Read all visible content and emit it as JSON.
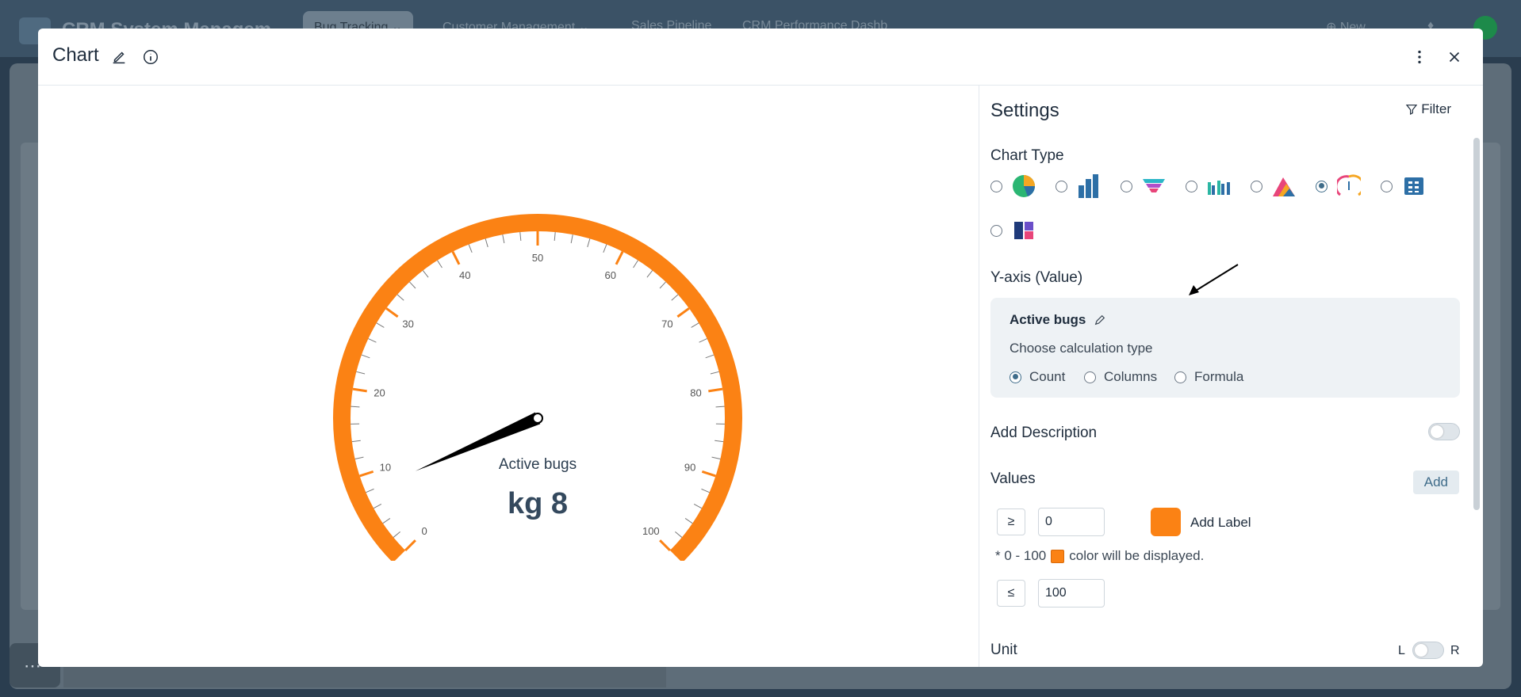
{
  "background": {
    "app_title": "CRM System Managem",
    "tabs": [
      {
        "label": "Bug Tracking  ⌄"
      },
      {
        "label": "Customer Management  ⌄"
      },
      {
        "label": "Sales Pipeline"
      },
      {
        "label": "CRM Performance Dashb"
      }
    ],
    "new_label": "⊕ New"
  },
  "modal": {
    "title": "Chart",
    "icons": [
      "edit-pencil-icon",
      "info-icon",
      "more-vert-icon",
      "close-icon"
    ]
  },
  "gauge": {
    "label": "Active bugs",
    "value_text": "kg 8",
    "value": 8,
    "min": 0,
    "max": 100,
    "ticks": [
      "0",
      "10",
      "20",
      "30",
      "40",
      "50",
      "60",
      "70",
      "80",
      "90",
      "100"
    ],
    "color": "#fb8214"
  },
  "settings": {
    "title": "Settings",
    "filter_label": "Filter",
    "chart_type_label": "Chart Type",
    "chart_types": [
      {
        "icon": "pie-chart-icon",
        "selected": false
      },
      {
        "icon": "bar-chart-icon",
        "selected": false
      },
      {
        "icon": "funnel-chart-icon",
        "selected": false
      },
      {
        "icon": "grouped-bar-chart-icon",
        "selected": false
      },
      {
        "icon": "area-chart-icon",
        "selected": false
      },
      {
        "icon": "gauge-chart-icon",
        "selected": true
      },
      {
        "icon": "pivot-table-icon",
        "selected": false
      },
      {
        "icon": "heatmap-icon",
        "selected": false
      }
    ],
    "yaxis_label": "Y-axis (Value)",
    "yaxis_name": "Active bugs",
    "calc_label": "Choose calculation type",
    "calc_options": [
      {
        "label": "Count",
        "selected": true
      },
      {
        "label": "Columns",
        "selected": false
      },
      {
        "label": "Formula",
        "selected": false
      }
    ],
    "add_description_label": "Add Description",
    "values_label": "Values",
    "add_button": "Add",
    "min_op": "≥",
    "min_value": "0",
    "max_op": "≤",
    "max_value": "100",
    "add_label_text": "Add Label",
    "range_note_prefix": "* 0 - 100",
    "range_note_suffix": "color will be displayed.",
    "swatch_color": "#fb8214",
    "unit_label": "Unit",
    "unit_toggle_left": "L",
    "unit_toggle_right": "R"
  }
}
